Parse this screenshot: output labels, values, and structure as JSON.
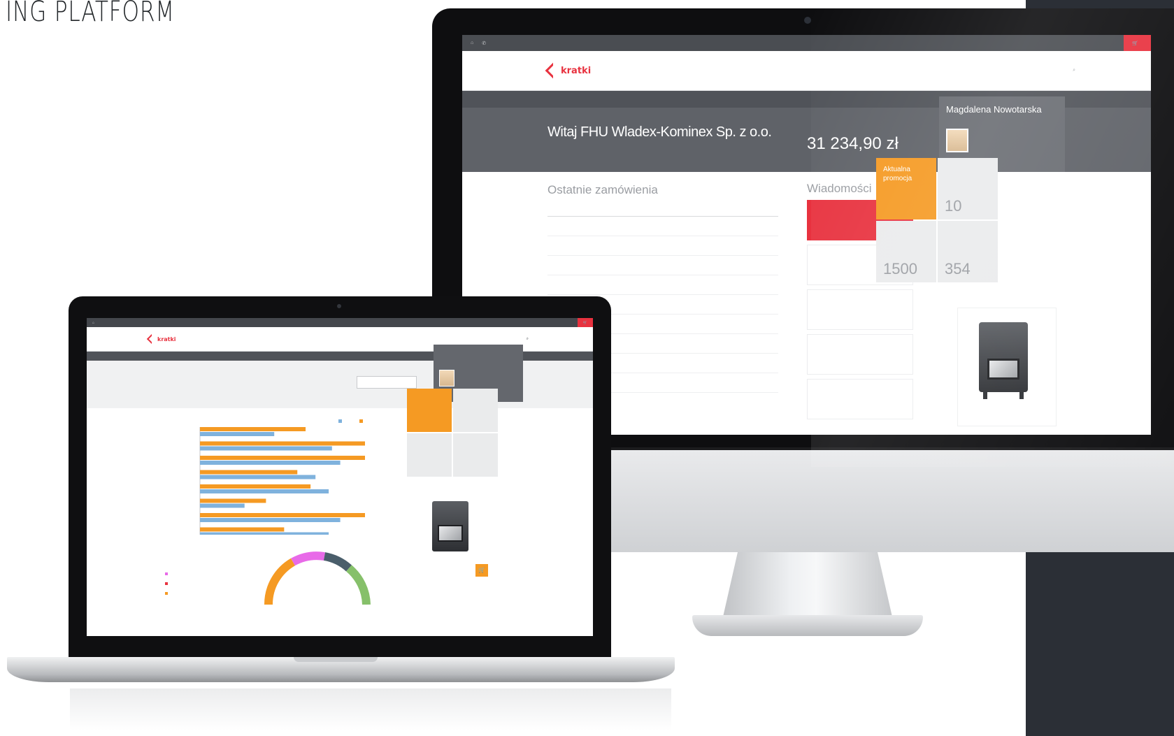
{
  "headline": "ING PLATFORM",
  "colors": {
    "brand_red": "#e8323f",
    "accent_orange": "#f59a23",
    "chart_blue": "#7fb2dd",
    "dark_gray": "#5f6268",
    "panel_dark": "#2b2f36"
  },
  "desktop": {
    "topbar": {
      "phone": "",
      "links": [
        "",
        ""
      ],
      "login": "",
      "cart": ""
    },
    "logo": "kratki",
    "nav": [
      "",
      "",
      "",
      "",
      "",
      "",
      "",
      "",
      ""
    ],
    "search": "",
    "subnav": [
      "",
      "",
      "",
      "",
      "",
      "",
      "",
      ""
    ],
    "subnav_right": [
      "",
      ""
    ],
    "hero": {
      "welcome": "Witaj FHU Wladex-Kominex Sp. z o.o.",
      "sub": "",
      "balance_label": "",
      "balance": "31 234,90 zł"
    },
    "manager": {
      "label": "",
      "name": "Magdalena Nowotarska",
      "contact": [
        "",
        "",
        ""
      ]
    },
    "orders": {
      "title": "Ostatnie zamówienia",
      "headers": [
        "",
        "",
        "",
        ""
      ],
      "rows": [
        [
          "",
          "",
          "",
          ""
        ],
        [
          "",
          "",
          "",
          ""
        ],
        [
          "",
          "",
          "",
          ""
        ],
        [
          "",
          "",
          "",
          ""
        ],
        [
          "",
          "",
          "",
          ""
        ],
        [
          "",
          "",
          "",
          ""
        ],
        [
          "",
          "",
          "",
          ""
        ],
        [
          "",
          "",
          "",
          ""
        ],
        [
          "",
          "",
          "",
          ""
        ]
      ]
    },
    "messages": {
      "title": "Wiadomości",
      "count": "",
      "items": [
        "",
        "",
        "",
        "",
        ""
      ]
    },
    "tiles": {
      "promo": {
        "label": "Aktualna promocja",
        "value": ""
      },
      "tile2": {
        "label": "",
        "value": "10"
      },
      "tile3": {
        "label": "",
        "value": "1500"
      },
      "tile4": {
        "label": "",
        "value": "354"
      }
    },
    "product": {
      "name": ""
    }
  },
  "laptop": {
    "topbar": {
      "links": [
        "",
        ""
      ],
      "cart": ""
    },
    "logo": "kratki",
    "nav": [
      "",
      "",
      "",
      "",
      "",
      "",
      "",
      "",
      ""
    ],
    "search": "",
    "subnav": [
      "",
      "",
      "",
      "",
      "",
      "",
      "",
      ""
    ],
    "subnav_right": [
      "",
      ""
    ],
    "hero": {
      "title": "",
      "button": ""
    },
    "manager": {
      "label": "",
      "name": "",
      "contact": [
        "",
        ""
      ]
    },
    "tiles": {
      "promo": {
        "label": "",
        "value": ""
      },
      "tile2": {
        "label": "",
        "value": ""
      },
      "tile3": {
        "label": "",
        "value": ""
      },
      "tile4": {
        "label": "",
        "value": ""
      }
    },
    "legend": [
      "",
      ""
    ],
    "arc_legend": [
      "",
      "",
      ""
    ],
    "product": {
      "name": "",
      "price": ""
    }
  },
  "chart_data": {
    "type": "bar",
    "categories": [
      "",
      "",
      "",
      "",
      "",
      "",
      "",
      ""
    ],
    "series": [
      {
        "values": [
          64,
          100,
          100,
          59,
          67,
          40,
          100,
          51
        ]
      },
      {
        "values": [
          45,
          80,
          85,
          70,
          78,
          27,
          85,
          78
        ]
      }
    ]
  }
}
